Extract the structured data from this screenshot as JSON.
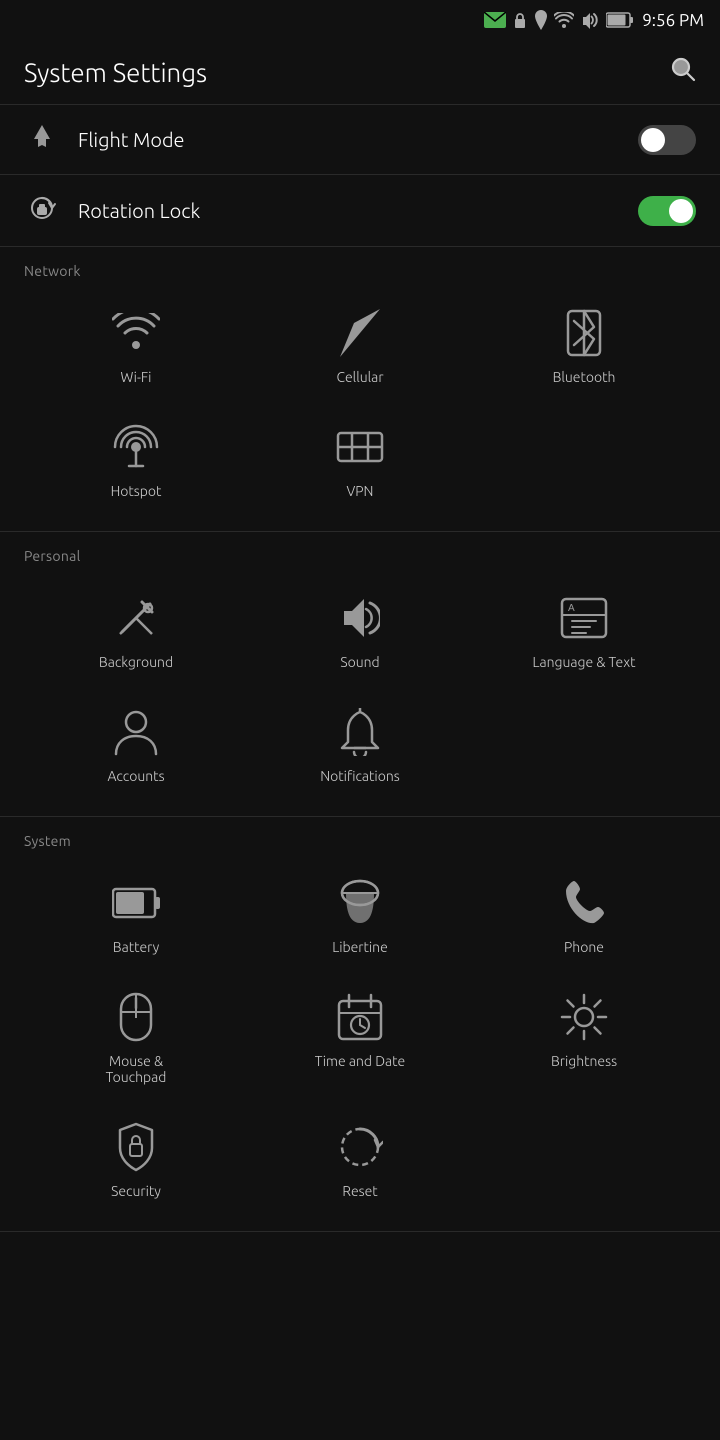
{
  "statusBar": {
    "time": "9:56 PM"
  },
  "header": {
    "title": "System Settings",
    "searchLabel": "Search"
  },
  "flightMode": {
    "label": "Flight Mode",
    "enabled": false
  },
  "rotationLock": {
    "label": "Rotation Lock",
    "enabled": true
  },
  "sections": [
    {
      "id": "network",
      "title": "Network",
      "items": [
        {
          "id": "wifi",
          "label": "Wi-Fi"
        },
        {
          "id": "cellular",
          "label": "Cellular"
        },
        {
          "id": "bluetooth",
          "label": "Bluetooth"
        },
        {
          "id": "hotspot",
          "label": "Hotspot"
        },
        {
          "id": "vpn",
          "label": "VPN"
        }
      ]
    },
    {
      "id": "personal",
      "title": "Personal",
      "items": [
        {
          "id": "background",
          "label": "Background"
        },
        {
          "id": "sound",
          "label": "Sound"
        },
        {
          "id": "language-text",
          "label": "Language & Text"
        },
        {
          "id": "accounts",
          "label": "Accounts"
        },
        {
          "id": "notifications",
          "label": "Notifications"
        }
      ]
    },
    {
      "id": "system",
      "title": "System",
      "items": [
        {
          "id": "battery",
          "label": "Battery"
        },
        {
          "id": "libertine",
          "label": "Libertine"
        },
        {
          "id": "phone",
          "label": "Phone"
        },
        {
          "id": "mouse-touchpad",
          "label": "Mouse &\nTouchpad"
        },
        {
          "id": "time-date",
          "label": "Time and Date"
        },
        {
          "id": "brightness",
          "label": "Brightness"
        },
        {
          "id": "security",
          "label": "Security"
        },
        {
          "id": "reset",
          "label": "Reset"
        }
      ]
    }
  ]
}
